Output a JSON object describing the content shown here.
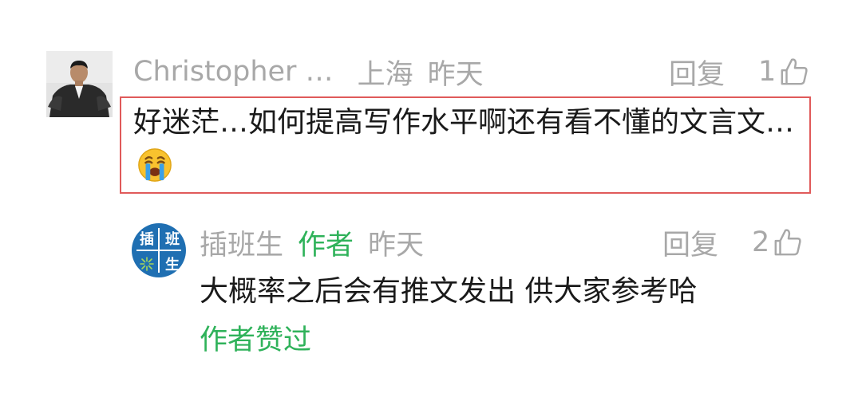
{
  "comment": {
    "user_name": "Christopher …",
    "location": "上海",
    "time": "昨天",
    "reply_label": "回复",
    "like_count": "1",
    "text": "好迷茫…如何提高写作水平啊还有看不懂的文言文…",
    "emoji_icon": "crying-face-emoji",
    "highlight_color": "#e05a5a"
  },
  "reply": {
    "user_name": "插班生",
    "author_tag": "作者",
    "time": "昨天",
    "reply_label": "回复",
    "like_count": "2",
    "text": "大概率之后会有推文发出 供大家参考哈",
    "author_liked": "作者赞过",
    "avatar_chars": [
      "插",
      "班",
      "",
      "生"
    ],
    "accent_color": "#2fb25a",
    "avatar_color": "#1f6fb2"
  }
}
